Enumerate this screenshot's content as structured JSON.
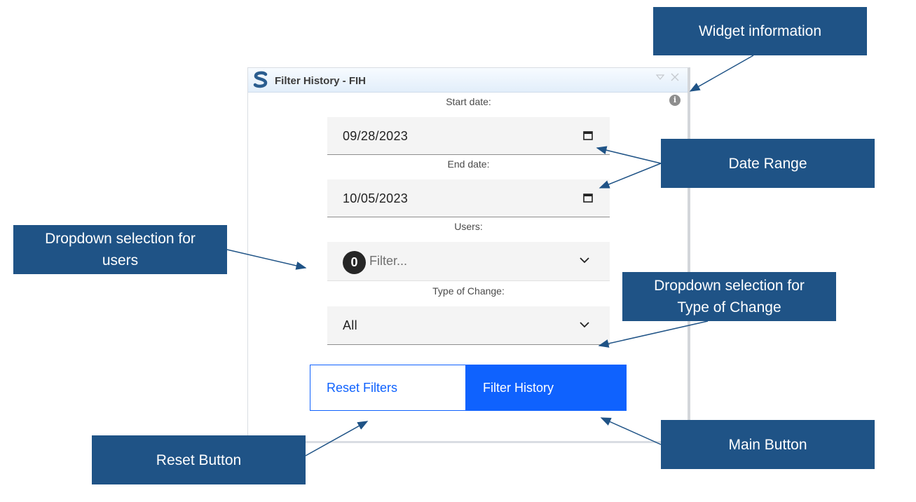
{
  "window": {
    "title": "Filter History - FIH"
  },
  "form": {
    "start_label": "Start date:",
    "start_value": "09/28/2023",
    "end_label": "End date:",
    "end_value": "10/05/2023",
    "users_label": "Users:",
    "users_count": "0",
    "users_placeholder": "Filter...",
    "type_label": "Type of Change:",
    "type_value": "All"
  },
  "buttons": {
    "reset_label": "Reset Filters",
    "main_label": "Filter History"
  },
  "callouts": {
    "widget_info": "Widget information",
    "date_range": "Date Range",
    "users_dropdown": "Dropdown selection for users",
    "type_dropdown": "Dropdown selection for Type of Change",
    "reset_button": "Reset Button",
    "main_button": "Main Button"
  },
  "colors": {
    "callout_bg": "#1f5386",
    "primary": "#0f62fe"
  },
  "icons": [
    "s-logo-icon",
    "minimize-icon",
    "close-icon",
    "info-icon",
    "calendar-icon",
    "chevron-down-icon"
  ]
}
